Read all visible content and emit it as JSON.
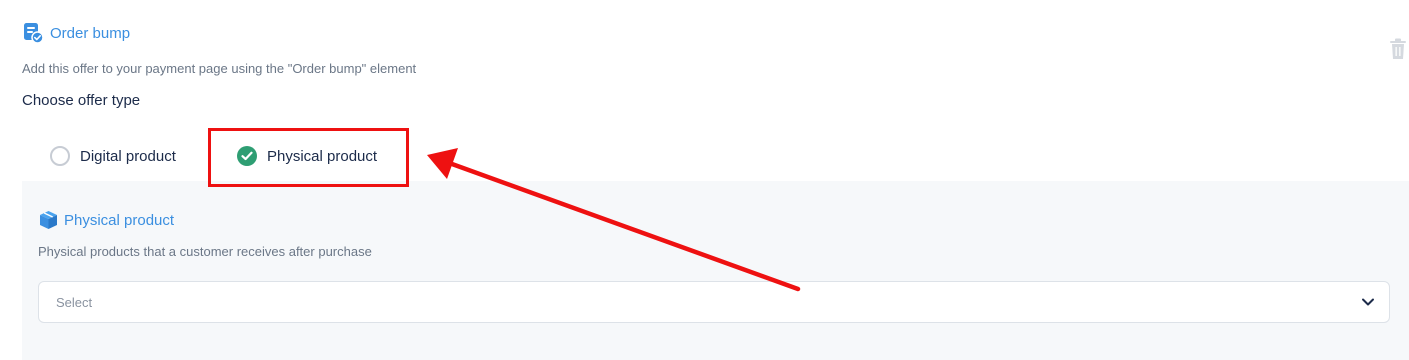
{
  "order_bump": {
    "title": "Order bump",
    "description": "Add this offer to your payment page using the \"Order bump\" element",
    "icon": "order-bump-icon"
  },
  "offer_type": {
    "heading": "Choose offer type",
    "options": [
      {
        "label": "Digital product",
        "selected": false
      },
      {
        "label": "Physical product",
        "selected": true
      }
    ]
  },
  "physical_panel": {
    "title": "Physical product",
    "description": "Physical products that a customer receives after purchase",
    "icon": "box-icon"
  },
  "select": {
    "placeholder": "Select"
  },
  "colors": {
    "accent": "#3b8fe0",
    "check": "#2e9e73",
    "annotation": "#ee1111"
  }
}
